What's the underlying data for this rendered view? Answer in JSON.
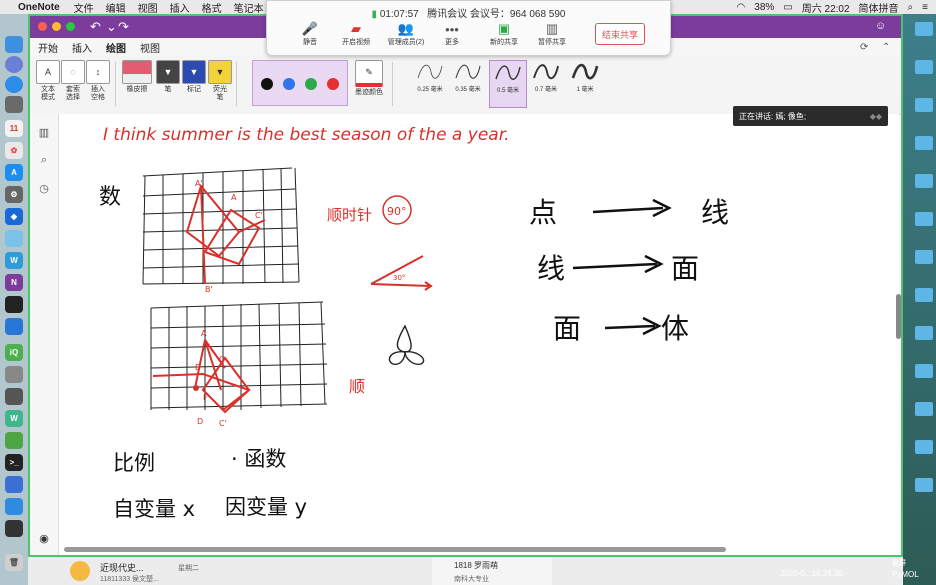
{
  "menubar": {
    "app_name": "OneNote",
    "items": [
      "文件",
      "编辑",
      "视图",
      "插入",
      "格式",
      "笔记本"
    ],
    "battery": "38%",
    "clock": "周六 22:02",
    "input_method": "简体拼音"
  },
  "tabs": [
    "开始",
    "插入",
    "绘图",
    "视图"
  ],
  "active_tab": "绘图",
  "ribbon": {
    "tools": [
      {
        "label": "文本\n模式",
        "icon": "A"
      },
      {
        "label": "套索\n选择",
        "icon": "◌"
      },
      {
        "label": "插入\n空格",
        "icon": "↕"
      }
    ],
    "eraser_label": "橡皮擦",
    "pen_label": "笔",
    "marker_label": "标记",
    "highlighter_label": "荧光\n笔",
    "ink_color_label": "墨迹颜色",
    "colors": [
      "#111111",
      "#2f74e8",
      "#2fa84a",
      "#e43030"
    ],
    "stroke_sizes": [
      "0.25 毫米",
      "0.35 毫米",
      "0.5 毫米",
      "0.7 毫米",
      "1 毫米"
    ],
    "selected_stroke": "0.5 毫米"
  },
  "meeting": {
    "timer": "01:07:57",
    "title": "腾讯会议 会议号：964 068 590",
    "buttons": [
      "静音",
      "开启视频",
      "管理成员(2)",
      "更多",
      "新的共享",
      "暂停共享"
    ],
    "end_share": "结束共享"
  },
  "speaking": "正在讲话: 嫣; 像鱼;",
  "ink": {
    "english_sentence": "I think summer is the best season of the a year.",
    "shu": "数",
    "shunshizhen": "顺时针",
    "deg90": "90°",
    "deg30": "30°",
    "shun": "顺",
    "line1": [
      "点",
      "线"
    ],
    "line2": [
      "线",
      "面"
    ],
    "line3": [
      "面",
      "体"
    ],
    "bili": "比例",
    "hanshu": "· 函数",
    "zibianliang": "自变量 x",
    "yinbianliang": "因变量 y",
    "labels": {
      "a": "A",
      "b": "B",
      "c": "C",
      "d": "D",
      "e": "E",
      "f": "F",
      "a1": "A'",
      "b1": "B'",
      "c1": "C'",
      "d1": "D'"
    }
  },
  "taskbar": {
    "item1": "近现代史...",
    "item1_sub": "11811333 侯文楚...",
    "item1_date": "星期二",
    "item2": "1818 罗雨萌",
    "item2_sub": "南科大专业",
    "screenshot_label": "截屏",
    "datetime": "2020-0...16.24.30",
    "pymol": "PyMOL"
  }
}
